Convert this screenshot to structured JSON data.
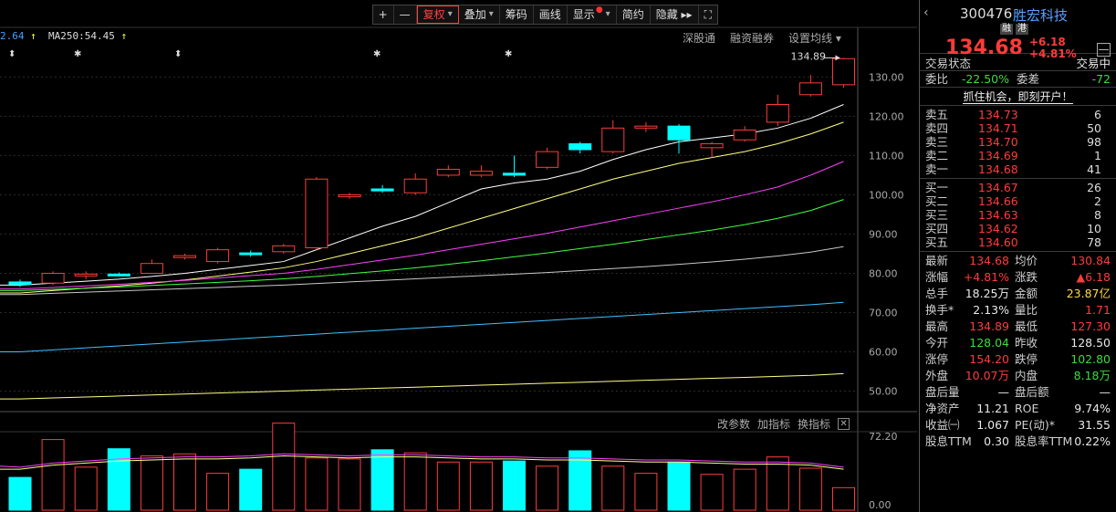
{
  "toolbar": {
    "items": [
      {
        "label": "+",
        "key": "zoom-in"
      },
      {
        "label": "—",
        "key": "zoom-out"
      },
      {
        "label": "复权",
        "key": "fuquan",
        "active": true,
        "dropdown": true
      },
      {
        "label": "叠加",
        "key": "overlay",
        "dropdown": true
      },
      {
        "label": "筹码",
        "key": "chips"
      },
      {
        "label": "画线",
        "key": "draw"
      },
      {
        "label": "显示",
        "key": "display",
        "dropdown": true,
        "dot": "●"
      },
      {
        "label": "简约",
        "key": "simple"
      },
      {
        "label": "隐藏 ▸▸",
        "key": "hide"
      },
      {
        "label": "⛶",
        "key": "fullscreen"
      }
    ]
  },
  "ma_labels": {
    "first": "2.64",
    "second": "MA250:54.45",
    "arrow": "↑"
  },
  "subbar": {
    "items": [
      "深股通",
      "融资融券",
      "设置均线 ▾"
    ]
  },
  "indicator_bar": {
    "items": [
      "改参数",
      "加指标",
      "换指标"
    ],
    "close": "✕"
  },
  "markers": [
    "⬍",
    "✱",
    "⬍",
    "✱",
    "✱"
  ],
  "high_label": "134.89",
  "chart_data": {
    "type": "candlestick",
    "yaxis_ticks": [
      "130.00",
      "120.00",
      "110.00",
      "100.00",
      "90.00",
      "80.00",
      "70.00",
      "60.00",
      "50.00"
    ],
    "ylim": [
      45,
      138
    ],
    "candles": [
      [
        77.8,
        78.4,
        76.5,
        77.2
      ],
      [
        77.5,
        80.5,
        77.0,
        80.0
      ],
      [
        79.5,
        80.5,
        78.5,
        79.8
      ],
      [
        79.8,
        80.2,
        79.2,
        79.5
      ],
      [
        80.0,
        83.5,
        79.8,
        82.5
      ],
      [
        84.0,
        85.0,
        83.5,
        84.5
      ],
      [
        83.0,
        86.5,
        82.5,
        86.0
      ],
      [
        85.2,
        85.8,
        84.2,
        85.0
      ],
      [
        85.5,
        87.5,
        85.0,
        87.0
      ],
      [
        86.5,
        104.5,
        86.0,
        104.0
      ],
      [
        99.5,
        100.5,
        99.0,
        100.0
      ],
      [
        101.5,
        102.5,
        100.5,
        101.0
      ],
      [
        100.5,
        105.5,
        100.0,
        104.0
      ],
      [
        105.0,
        107.5,
        104.5,
        106.5
      ],
      [
        105.0,
        107.5,
        104.5,
        106.0
      ],
      [
        105.5,
        110.0,
        104.5,
        105.0
      ],
      [
        107.0,
        112.0,
        106.5,
        111.0
      ],
      [
        113.0,
        113.5,
        110.5,
        111.5
      ],
      [
        111.0,
        119.0,
        110.5,
        117.0
      ],
      [
        117.0,
        118.5,
        116.0,
        117.5
      ],
      [
        117.5,
        118.0,
        110.5,
        114.0
      ],
      [
        112.0,
        113.5,
        109.5,
        113.0
      ],
      [
        114.0,
        117.5,
        113.5,
        116.5
      ],
      [
        118.5,
        125.5,
        117.5,
        123.0
      ],
      [
        125.5,
        130.5,
        125.0,
        128.5
      ],
      [
        128.04,
        134.89,
        127.3,
        134.68
      ]
    ],
    "ma_series": [
      {
        "color": "#ffffff",
        "values": [
          77.0,
          77.5,
          78.0,
          78.5,
          79.2,
          80.0,
          81.0,
          82.0,
          83.0,
          86.0,
          89.0,
          92.0,
          94.5,
          98.0,
          101.5,
          103.0,
          104.0,
          106.0,
          109.0,
          111.5,
          113.5,
          114.5,
          115.5,
          117.0,
          119.5,
          123.0
        ]
      },
      {
        "color": "#ffff80",
        "values": [
          75.0,
          75.6,
          76.2,
          76.8,
          77.5,
          78.3,
          79.3,
          80.3,
          81.4,
          83.0,
          85.0,
          87.0,
          89.0,
          91.5,
          94.0,
          96.5,
          99.0,
          101.5,
          104.0,
          106.0,
          108.0,
          109.5,
          111.0,
          113.0,
          115.5,
          118.5
        ]
      },
      {
        "color": "#ff40ff",
        "values": [
          76.0,
          76.4,
          76.8,
          77.2,
          77.7,
          78.2,
          78.8,
          79.4,
          80.0,
          81.0,
          82.2,
          83.4,
          84.6,
          86.0,
          87.4,
          88.8,
          90.2,
          91.8,
          93.4,
          95.0,
          96.6,
          98.2,
          100.0,
          102.0,
          105.0,
          108.5
        ]
      },
      {
        "color": "#40ff40",
        "values": [
          75.6,
          75.9,
          76.2,
          76.5,
          76.9,
          77.3,
          77.7,
          78.1,
          78.6,
          79.2,
          79.9,
          80.6,
          81.4,
          82.3,
          83.2,
          84.2,
          85.2,
          86.3,
          87.4,
          88.6,
          89.8,
          91.0,
          92.4,
          94.0,
          96.0,
          98.8
        ]
      },
      {
        "color": "#c8c8c8",
        "values": [
          74.6,
          74.9,
          75.2,
          75.5,
          75.8,
          76.1,
          76.4,
          76.7,
          77.0,
          77.4,
          77.8,
          78.2,
          78.6,
          79.0,
          79.4,
          79.8,
          80.2,
          80.7,
          81.2,
          81.7,
          82.3,
          82.9,
          83.6,
          84.4,
          85.4,
          86.8
        ]
      },
      {
        "color": "#40c0ff",
        "values": [
          60.0,
          60.5,
          61.0,
          61.5,
          62.0,
          62.5,
          63.0,
          63.5,
          64.0,
          64.5,
          65.0,
          65.5,
          66.0,
          66.5,
          67.0,
          67.5,
          68.0,
          68.5,
          69.0,
          69.5,
          70.0,
          70.5,
          71.0,
          71.5,
          72.0,
          72.6
        ]
      },
      {
        "color": "#ffff80",
        "values": [
          48.0,
          48.25,
          48.5,
          48.75,
          49.0,
          49.25,
          49.5,
          49.75,
          50.0,
          50.25,
          50.5,
          50.75,
          51.0,
          51.25,
          51.5,
          51.75,
          52.0,
          52.25,
          52.5,
          52.75,
          53.0,
          53.25,
          53.5,
          53.75,
          54.0,
          54.45
        ]
      }
    ],
    "volume_ticks": [
      "72.20",
      "0.00"
    ],
    "volume_ylim": [
      0,
      72.2
    ],
    "volume": [
      32,
      69,
      42,
      60,
      53,
      55,
      36,
      40,
      85,
      51,
      50,
      59,
      56,
      47,
      47,
      48,
      43,
      58,
      43,
      36,
      47,
      35,
      40,
      52,
      41,
      22
    ],
    "volume_ma": [
      40,
      44,
      46,
      48,
      49,
      50,
      50,
      51,
      53,
      52,
      51,
      52,
      52,
      51,
      50,
      50,
      49,
      49,
      48,
      47,
      47,
      46,
      45,
      45,
      44,
      40
    ]
  },
  "panel": {
    "nav": "‹",
    "code": "300476",
    "name": "胜宏科技",
    "tags": [
      "融",
      "港"
    ],
    "price": "134.68",
    "change": "+6.18",
    "change_pct": "+4.81%",
    "minus": "—",
    "status_label": "交易状态",
    "status_value": "交易中",
    "weibi_label": "委比",
    "weibi_value": "-22.50%",
    "weicha_label": "委差",
    "weicha_value": "-72",
    "promo": "抓住机会，即刻开户！",
    "sells": [
      {
        "label": "卖五",
        "price": "134.73",
        "vol": "6"
      },
      {
        "label": "卖四",
        "price": "134.71",
        "vol": "50"
      },
      {
        "label": "卖三",
        "price": "134.70",
        "vol": "98"
      },
      {
        "label": "卖二",
        "price": "134.69",
        "vol": "1"
      },
      {
        "label": "卖一",
        "price": "134.68",
        "vol": "41"
      }
    ],
    "buys": [
      {
        "label": "买一",
        "price": "134.67",
        "vol": "26"
      },
      {
        "label": "买二",
        "price": "134.66",
        "vol": "2"
      },
      {
        "label": "买三",
        "price": "134.63",
        "vol": "8"
      },
      {
        "label": "买四",
        "price": "134.62",
        "vol": "10"
      },
      {
        "label": "买五",
        "price": "134.60",
        "vol": "78"
      }
    ],
    "stats": [
      {
        "l1": "最新",
        "v1": "134.68",
        "c1": "red",
        "l2": "均价",
        "v2": "130.84",
        "c2": "red"
      },
      {
        "l1": "涨幅",
        "v1": "+4.81%",
        "c1": "red",
        "l2": "涨跌",
        "v2": "▲6.18",
        "c2": "red"
      },
      {
        "l1": "总手",
        "v1": "18.25万",
        "c1": "white",
        "l2": "金额",
        "v2": "23.87亿",
        "c2": "yellow"
      },
      {
        "l1": "换手*",
        "v1": "2.13%",
        "c1": "white",
        "l2": "量比",
        "v2": "1.71",
        "c2": "red"
      },
      {
        "l1": "最高",
        "v1": "134.89",
        "c1": "red",
        "l2": "最低",
        "v2": "127.30",
        "c2": "red"
      },
      {
        "l1": "今开",
        "v1": "128.04",
        "c1": "green",
        "l2": "昨收",
        "v2": "128.50",
        "c2": "white"
      },
      {
        "l1": "涨停",
        "v1": "154.20",
        "c1": "red",
        "l2": "跌停",
        "v2": "102.80",
        "c2": "green"
      },
      {
        "l1": "外盘",
        "v1": "10.07万",
        "c1": "red",
        "l2": "内盘",
        "v2": "8.18万",
        "c2": "green"
      },
      {
        "l1": "盘后量",
        "v1": "—",
        "c1": "white",
        "l2": "盘后额",
        "v2": "—",
        "c2": "white"
      },
      {
        "l1": "净资产",
        "v1": "11.21",
        "c1": "white",
        "l2": "ROE",
        "v2": "9.74%",
        "c2": "white"
      },
      {
        "l1": "收益㈠",
        "v1": "1.067",
        "c1": "white",
        "l2": "PE(动)*",
        "v2": "31.55",
        "c2": "white"
      },
      {
        "l1": "股息TTM",
        "v1": "0.30",
        "c1": "white",
        "l2": "股息率TTM",
        "v2": "0.22%",
        "c2": "white"
      }
    ]
  },
  "colors": {
    "up": "#ff3b3b",
    "down": "#00ffff",
    "grid": "#2a2a2a"
  }
}
